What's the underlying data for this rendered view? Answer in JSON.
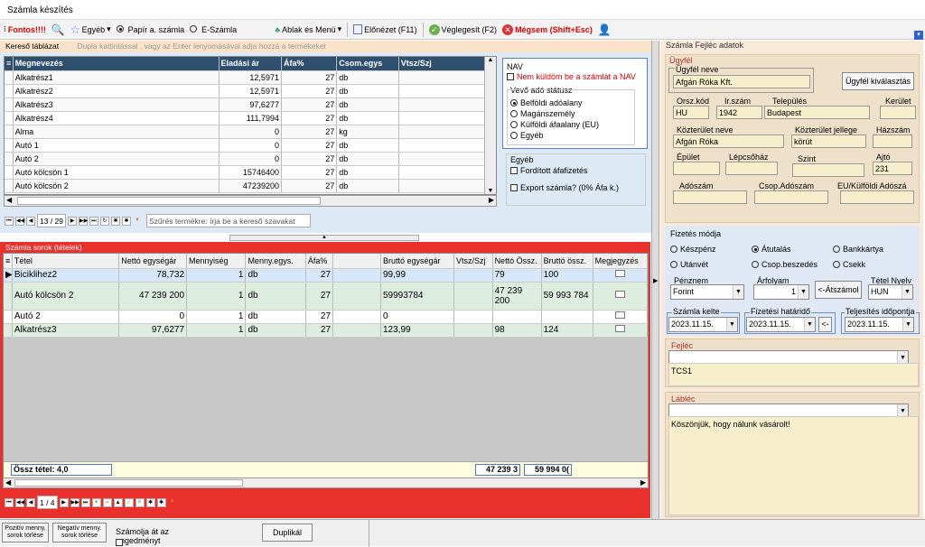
{
  "window": {
    "title": "Számla készítés"
  },
  "toolbar": {
    "fontos": "Fontos!!!!",
    "egyeb": "Egyéb",
    "papir": "Papír a. számla",
    "eszamla": "E-Számla",
    "ablak": "Ablak és Menü",
    "elonezet": "Előnézet (F11)",
    "veglegesit": "Véglegesít (F2)",
    "megsem": "Mégsem (Shift+Esc)"
  },
  "search_panel": {
    "title": "Kereső táblázat",
    "hint": "Dupla kattintással , vagy az Enter lenyomásával adja hozzá a termékeket",
    "columns": [
      "Megnevezés",
      "Eladási ár",
      "Áfa%",
      "Csom.egys",
      "Vtsz/Szj"
    ],
    "rows": [
      [
        "Alkatrész1",
        "12,5971",
        "27",
        "db",
        ""
      ],
      [
        "Alkatrész2",
        "12,5971",
        "27",
        "db",
        ""
      ],
      [
        "Alkatrész3",
        "97,6277",
        "27",
        "db",
        ""
      ],
      [
        "Alkatrész4",
        "111,7994",
        "27",
        "db",
        ""
      ],
      [
        "Alma",
        "0",
        "27",
        "kg",
        ""
      ],
      [
        "Autó 1",
        "0",
        "27",
        "db",
        ""
      ],
      [
        "Autó 2",
        "0",
        "27",
        "db",
        ""
      ],
      [
        "Autó kölcsön 1",
        "15746400",
        "27",
        "db",
        ""
      ],
      [
        "Autó kölcsön 2",
        "47239200",
        "27",
        "db",
        ""
      ]
    ],
    "pager": "13 / 29",
    "filter_placeholder": "Szűrés termékre: írja be a kereső szavakat"
  },
  "nav_box": {
    "title": "NAV",
    "nem_kuld": "Nem küldöm be a számlát a NAV",
    "vevo_status": "Vevő adó státusz",
    "options": [
      "Belföldi adóalany",
      "Magánszemély",
      "Külföldi áfaalany (EU)",
      "Egyéb"
    ],
    "selected": 0
  },
  "egyeb_box": {
    "title": "Egyéb",
    "forditott": "Fordított áfafizetés",
    "export": "Export számla? (0% Áfa k.)"
  },
  "lines_panel": {
    "title": "Számla sorok (tételek)",
    "columns": [
      "Tétel",
      "Nettó egységár",
      "Mennyiség",
      "Menny.egys.",
      "Áfa%",
      "",
      "Bruttó egységár",
      "Vtsz/Szj",
      "Nettó Össz.",
      "Bruttó össz.",
      "Megjegyzés"
    ],
    "rows": [
      {
        "tetel": "Biciklihez2",
        "netto": "78,732",
        "menny": "1",
        "egys": "db",
        "afa": "27",
        "brutto": "99,99",
        "vtsz": "",
        "nosszl": "79",
        "bossz": "100"
      },
      {
        "tetel": "Autó kölcsön 2",
        "netto": "47 239 200",
        "menny": "1",
        "egys": "db",
        "afa": "27",
        "brutto": "59993784",
        "vtsz": "",
        "nosszl": "47 239 200",
        "bossz": "59 993 784"
      },
      {
        "tetel": "Autó 2",
        "netto": "0",
        "menny": "1",
        "egys": "db",
        "afa": "27",
        "brutto": "0",
        "vtsz": "",
        "nosszl": "",
        "bossz": ""
      },
      {
        "tetel": "Alkatrész3",
        "netto": "97,6277",
        "menny": "1",
        "egys": "db",
        "afa": "27",
        "brutto": "123,99",
        "vtsz": "",
        "nosszl": "98",
        "bossz": "124"
      }
    ],
    "sum_label": "Össz tétel: 4,0",
    "sum_netto": "47 239 3",
    "sum_brutto": "59 994 0(",
    "pager": "1 / 4"
  },
  "header_panel": {
    "title": "Számla Fejléc adatok",
    "ugyfel_group": "Ügyfél",
    "ugyfel_neve_label": "Ügyfél neve",
    "ugyfel_neve": "Afgán Róka Kft.",
    "ugyfel_btn": "Ügyfél kiválasztás",
    "orszkod_label": "Orsz.kód",
    "orszkod": "HU",
    "irszam_label": "Ir.szám",
    "irszam": "1942",
    "telepules_label": "Település",
    "telepules": "Budapest",
    "kerulet_label": "Kerület",
    "kerulet": "",
    "kozterulet_label": "Közterület neve",
    "kozterulet": "Afgán Róka",
    "jelleg_label": "Közterület jellege",
    "jelleg": "körút",
    "hazszam_label": "Házszám",
    "hazszam": "",
    "epulet_label": "Épület",
    "epulet": "",
    "lepcsohaz_label": "Lépcsőház",
    "lepcsohaz": "",
    "szint_label": "Szint",
    "szint": "",
    "ajto_label": "Ajtó",
    "ajto": "231",
    "adoszam_label": "Adószám",
    "adoszam": "",
    "csopado_label": "Csop.Adószám",
    "csopado": "",
    "euado_label": "EU/Külföldi Adószá",
    "euado": ""
  },
  "payment": {
    "title": "Fizetés módja",
    "options": [
      "Készpénz",
      "Átutalás",
      "Bankkártya",
      "Utánvét",
      "Csop.beszedés",
      "Csekk"
    ],
    "selected": 1,
    "penznem_label": "Pénznem",
    "penznem": "Forint",
    "arfolyam_label": "Árfolyam",
    "arfolyam": "1",
    "atszamol_btn": "<-Átszámol",
    "nyelv_label": "Tétel Nyelv",
    "nyelv": "HUN",
    "kelte_label": "Számla kelte",
    "kelte": "2023.11.15.",
    "hatarido_label": "Fizetési határidő",
    "hatarido": "2023.11.15.",
    "copy_btn": "<-",
    "teljesites_label": "Teljesítés időpontja",
    "teljesites": "2023.11.15."
  },
  "fejlec": {
    "title": "Fejléc",
    "text": "TCS1"
  },
  "lablec": {
    "title": "Lábléc",
    "text": "Köszönjük, hogy nálunk vásárolt!"
  },
  "bottom": {
    "poz_btn": "Pozitív menny. sorok törlése",
    "neg_btn": "Negatív menny. sorok törlése",
    "szamolja": "Számolja át az engedményt",
    "duplikal": "Duplikál"
  }
}
